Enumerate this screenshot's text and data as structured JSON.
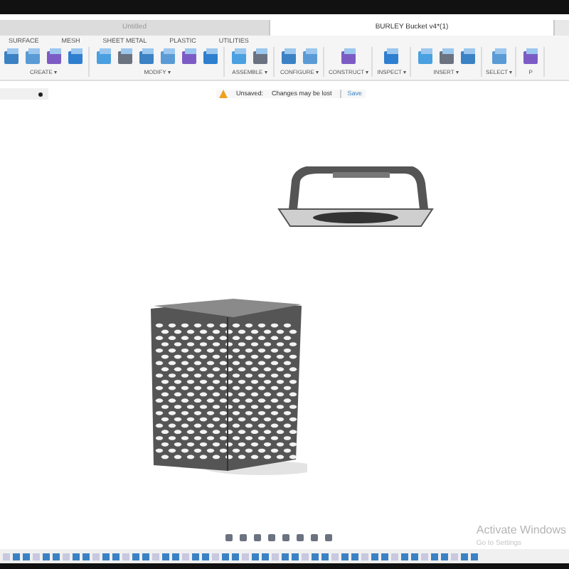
{
  "document_tabs": [
    {
      "title": "Untitled",
      "selected": false
    },
    {
      "title": "BURLEY Bucket v4*(1)",
      "selected": true
    }
  ],
  "toolbar_tabs": [
    {
      "label": "SURFACE"
    },
    {
      "label": "MESH"
    },
    {
      "label": "SHEET METAL"
    },
    {
      "label": "PLASTIC"
    },
    {
      "label": "UTILITIES"
    }
  ],
  "tool_groups": [
    {
      "label": "CREATE ▾"
    },
    {
      "label": "MODIFY ▾"
    },
    {
      "label": "ASSEMBLE ▾"
    },
    {
      "label": "CONFIGURE ▾"
    },
    {
      "label": "CONSTRUCT ▾"
    },
    {
      "label": "INSPECT ▾"
    },
    {
      "label": "INSERT ▾"
    },
    {
      "label": "SELECT ▾"
    },
    {
      "label": "P"
    }
  ],
  "notice": {
    "status": "Unsaved:",
    "message": "Changes may be lost",
    "action": "Save"
  },
  "os_overlay": {
    "title": "Activate Windows",
    "subtitle": "Go to Settings"
  }
}
